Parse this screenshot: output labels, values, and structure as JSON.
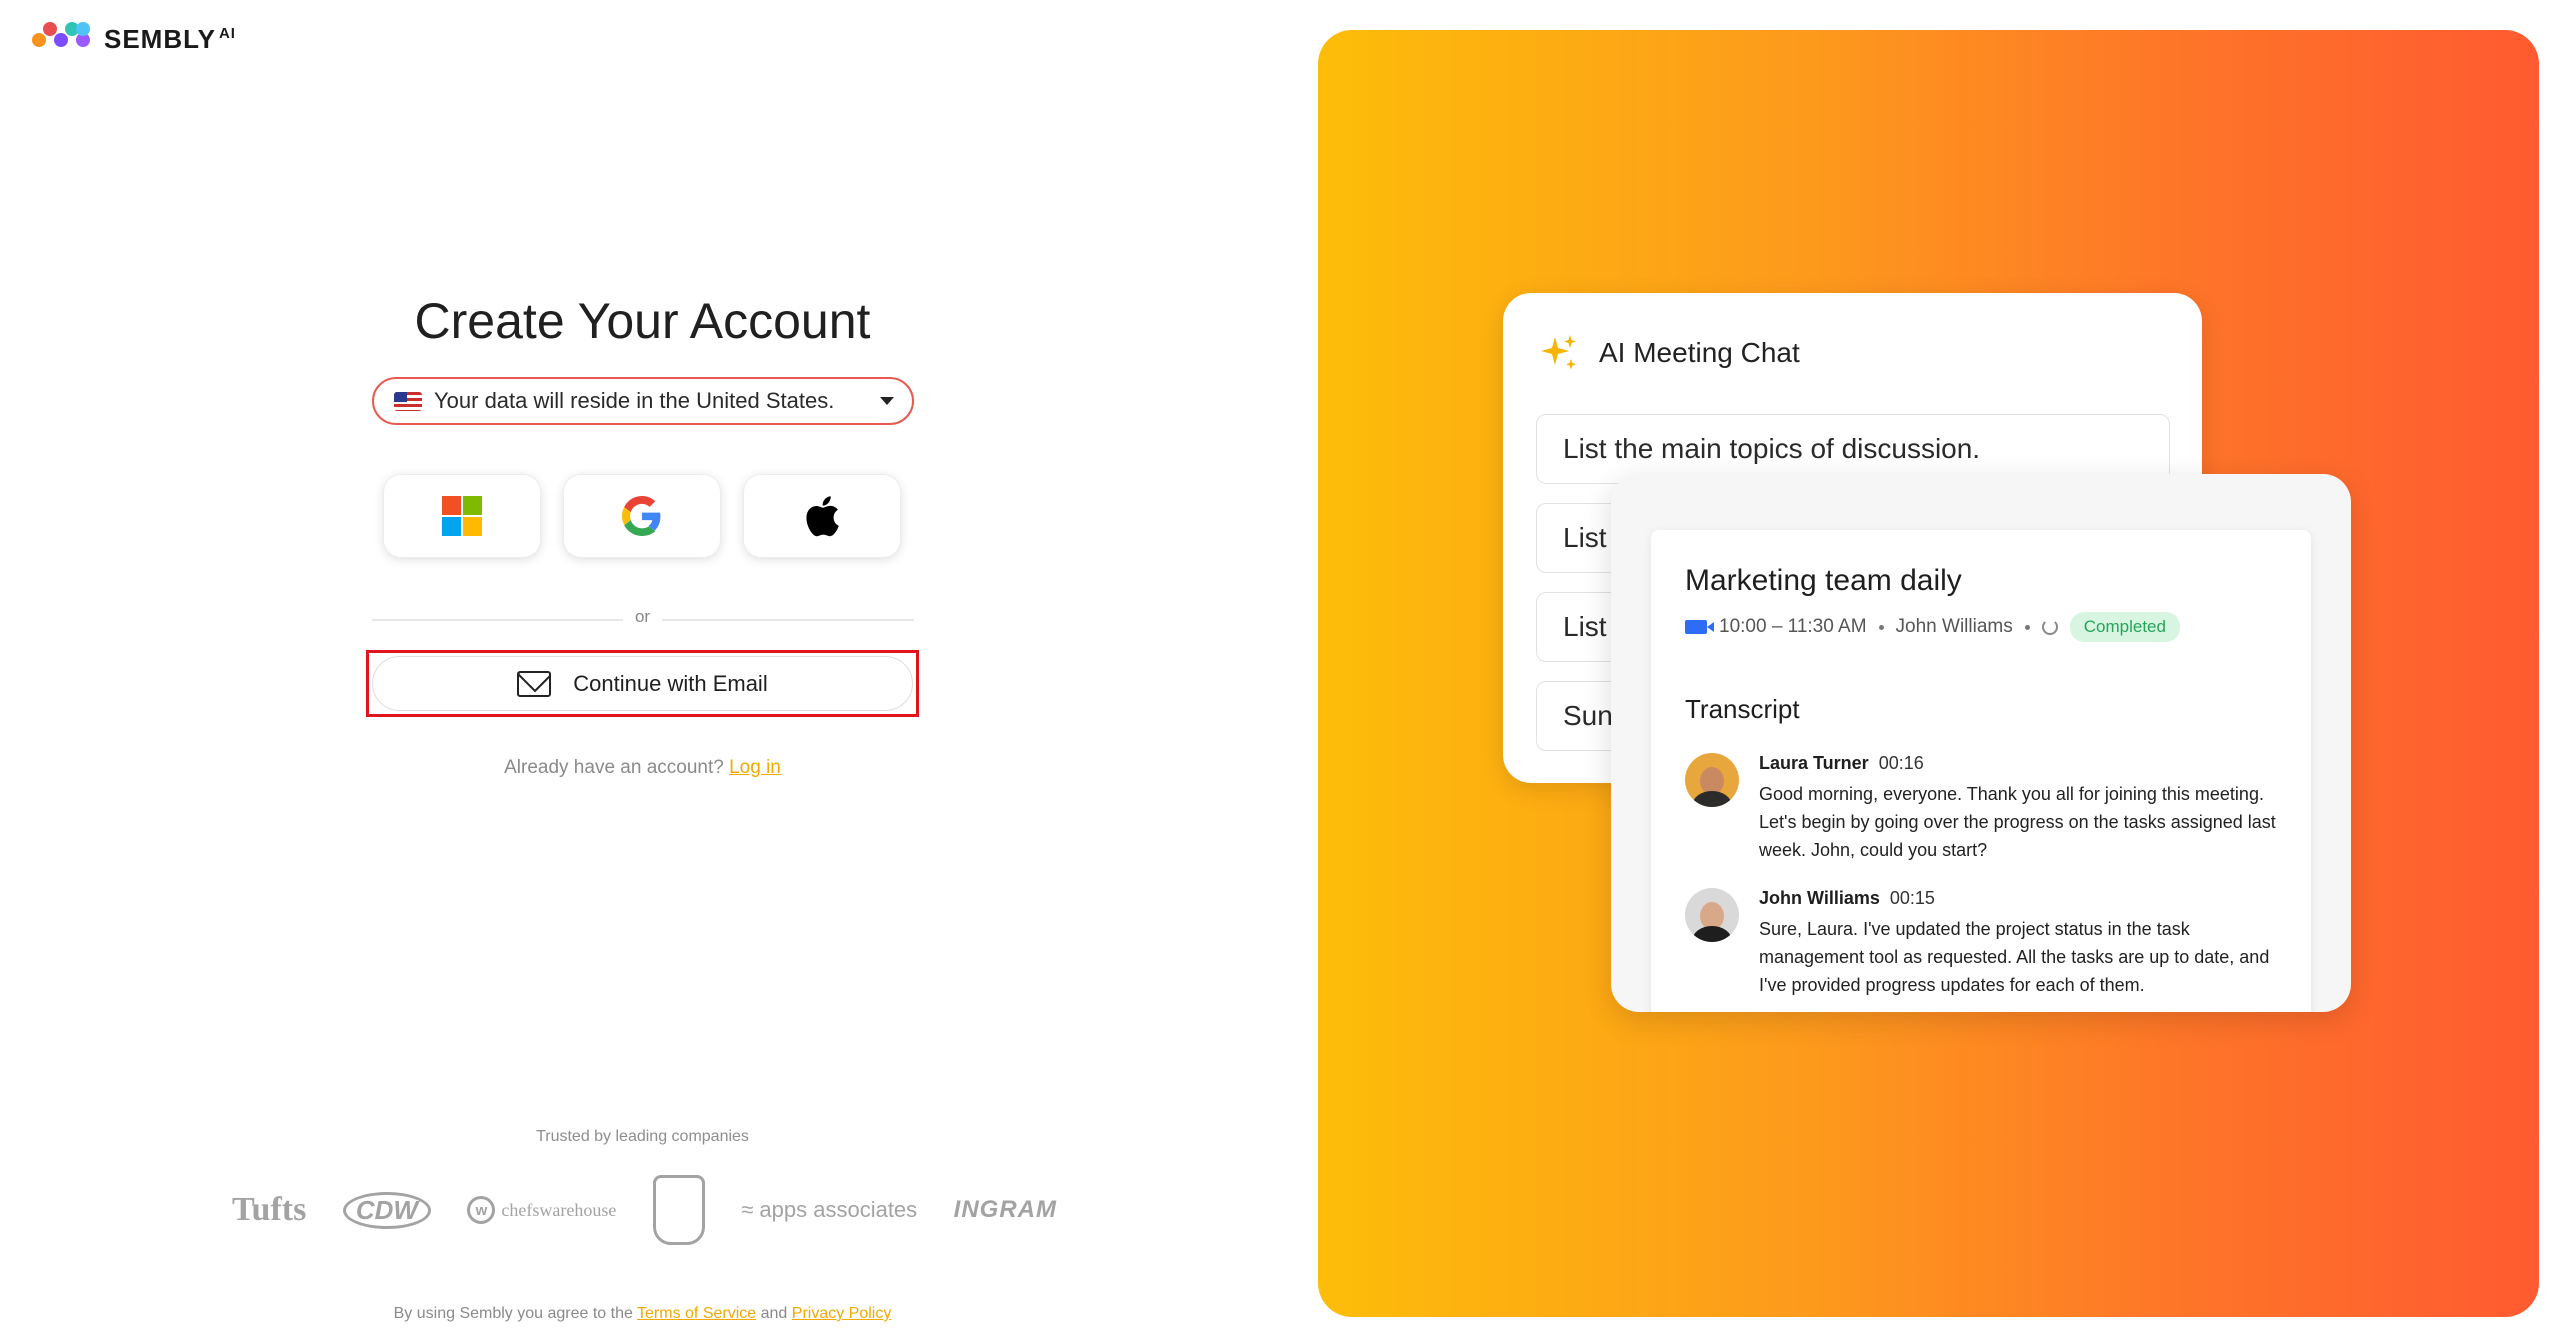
{
  "brand": {
    "name": "SEMBLY",
    "suffix": "AI"
  },
  "signup": {
    "title": "Create Your Account",
    "region_text": "Your data will reside in the United States.",
    "sso": [
      {
        "provider": "Microsoft",
        "icon": "microsoft-icon"
      },
      {
        "provider": "Google",
        "icon": "google-icon"
      },
      {
        "provider": "Apple",
        "icon": "apple-icon"
      }
    ],
    "or_label": "or",
    "email_button": "Continue with Email",
    "login_prompt": "Already have an account?",
    "login_link": "Log in"
  },
  "trusted": {
    "label": "Trusted by leading companies",
    "companies": [
      "Tufts",
      "CDW",
      "chefswarehouse",
      "shield-logo",
      "apps associates",
      "INGRAM"
    ]
  },
  "legal": {
    "prefix": "By using Sembly you agree to the",
    "terms": "Terms of Service",
    "and": "and",
    "privacy": "Privacy Policy"
  },
  "hero": {
    "chat": {
      "title": "AI Meeting Chat",
      "prompts": [
        "List the main topics of discussion.",
        "List",
        "List",
        "Sun"
      ]
    },
    "meeting": {
      "title": "Marketing team daily",
      "time": "10:00 – 11:30 AM",
      "host": "John Williams",
      "status": "Completed",
      "transcript_heading": "Transcript",
      "entries": [
        {
          "speaker": "Laura Turner",
          "time": "00:16",
          "text": "Good morning, everyone. Thank you all for joining this meeting. Let's begin by going over the progress on the tasks assigned last week. John, could you start?"
        },
        {
          "speaker": "John Williams",
          "time": "00:15",
          "text": "Sure, Laura. I've updated the project status in the task management tool as requested. All the tasks are up to date, and I've provided progress updates for each of them."
        }
      ]
    }
  },
  "colors": {
    "accent_link": "#f2a900",
    "highlight_box": "#e0141c",
    "region_border": "#e85a4f",
    "gradient_start": "#fdbd09",
    "gradient_end": "#ff5a31",
    "completed_badge": "#26a55a"
  }
}
